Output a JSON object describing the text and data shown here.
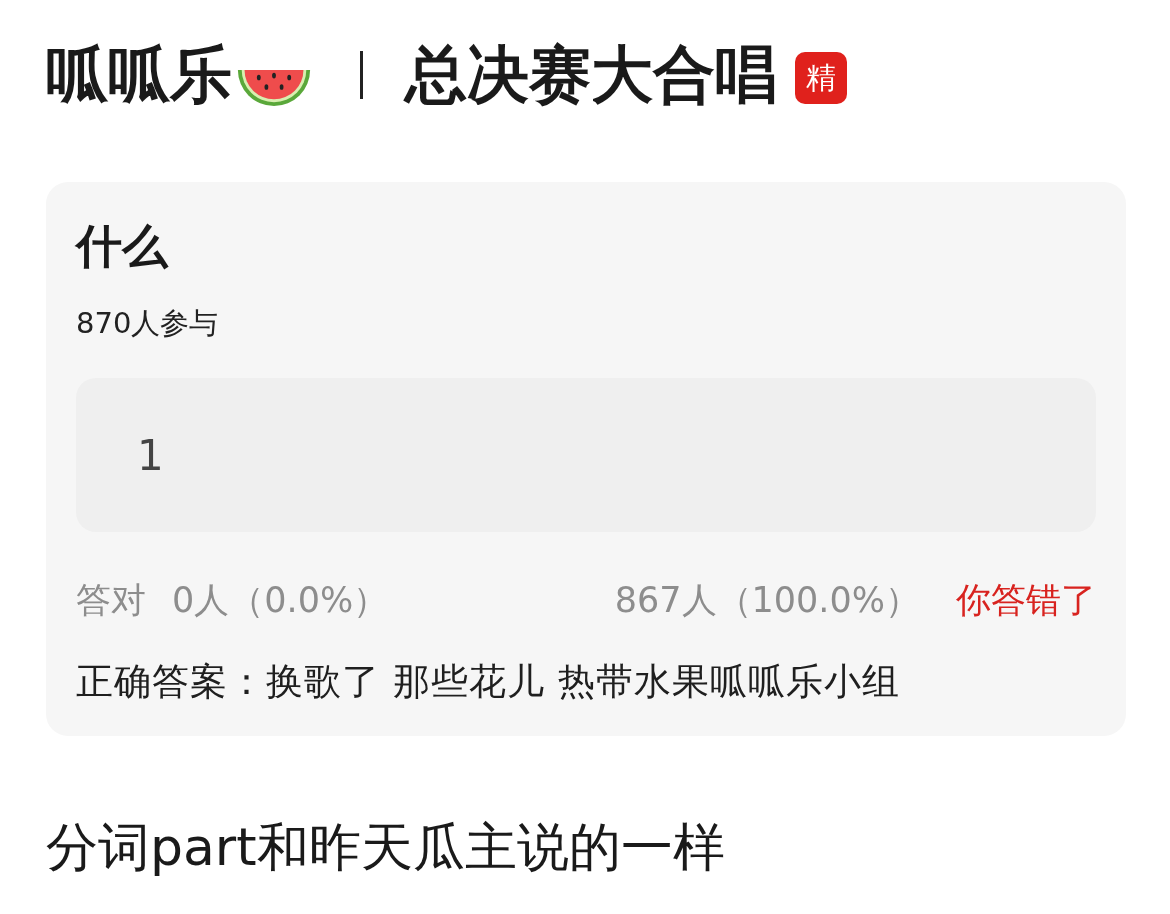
{
  "post_header": {
    "group_name": "呱呱乐",
    "section": "总决赛大合唱",
    "badge": "精"
  },
  "quiz_card": {
    "question": "什么",
    "participants": "870人参与",
    "answer_box": {
      "value": "1"
    },
    "correct_stat": {
      "label": "答对",
      "count": "0人（0.0%）"
    },
    "wrong_stat": {
      "count": "867人（100.0%）",
      "verdict": "你答错了",
      "user_correct": false
    },
    "correct_answer": "正确答案：换歌了 那些花儿 热带水果呱呱乐小组"
  },
  "body_text": "分词part和昨天瓜主说的一样"
}
